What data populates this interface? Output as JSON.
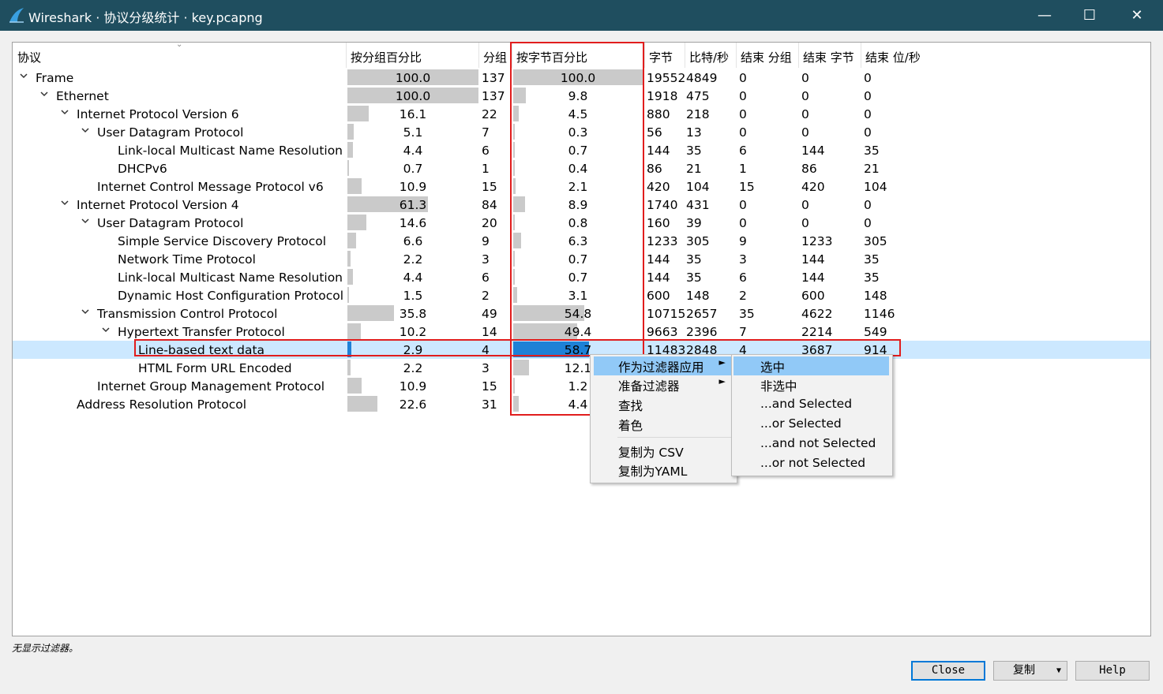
{
  "window": {
    "title": "Wireshark · 协议分级统计 · key.pcapng"
  },
  "columns": [
    "协议",
    "按分组百分比",
    "分组",
    "按字节百分比",
    "字节",
    "比特/秒",
    "结束 分组",
    "结束 字节",
    "结束 位/秒"
  ],
  "rows": [
    {
      "depth": 0,
      "expand": true,
      "name": "Frame",
      "pkt_pct": "100.0",
      "pkts": "137",
      "byte_pct": "100.0",
      "bytes": "19552",
      "bps": "4849",
      "end_pkts": "0",
      "end_bytes": "0",
      "end_bps": "0"
    },
    {
      "depth": 1,
      "expand": true,
      "name": "Ethernet",
      "pkt_pct": "100.0",
      "pkts": "137",
      "byte_pct": "9.8",
      "bytes": "1918",
      "bps": "475",
      "end_pkts": "0",
      "end_bytes": "0",
      "end_bps": "0"
    },
    {
      "depth": 2,
      "expand": true,
      "name": "Internet Protocol Version 6",
      "pkt_pct": "16.1",
      "pkts": "22",
      "byte_pct": "4.5",
      "bytes": "880",
      "bps": "218",
      "end_pkts": "0",
      "end_bytes": "0",
      "end_bps": "0"
    },
    {
      "depth": 3,
      "expand": true,
      "name": "User Datagram Protocol",
      "pkt_pct": "5.1",
      "pkts": "7",
      "byte_pct": "0.3",
      "bytes": "56",
      "bps": "13",
      "end_pkts": "0",
      "end_bytes": "0",
      "end_bps": "0"
    },
    {
      "depth": 4,
      "expand": false,
      "name": "Link-local Multicast Name Resolution",
      "pkt_pct": "4.4",
      "pkts": "6",
      "byte_pct": "0.7",
      "bytes": "144",
      "bps": "35",
      "end_pkts": "6",
      "end_bytes": "144",
      "end_bps": "35"
    },
    {
      "depth": 4,
      "expand": false,
      "name": "DHCPv6",
      "pkt_pct": "0.7",
      "pkts": "1",
      "byte_pct": "0.4",
      "bytes": "86",
      "bps": "21",
      "end_pkts": "1",
      "end_bytes": "86",
      "end_bps": "21"
    },
    {
      "depth": 3,
      "expand": false,
      "name": "Internet Control Message Protocol v6",
      "pkt_pct": "10.9",
      "pkts": "15",
      "byte_pct": "2.1",
      "bytes": "420",
      "bps": "104",
      "end_pkts": "15",
      "end_bytes": "420",
      "end_bps": "104"
    },
    {
      "depth": 2,
      "expand": true,
      "name": "Internet Protocol Version 4",
      "pkt_pct": "61.3",
      "pkts": "84",
      "byte_pct": "8.9",
      "bytes": "1740",
      "bps": "431",
      "end_pkts": "0",
      "end_bytes": "0",
      "end_bps": "0"
    },
    {
      "depth": 3,
      "expand": true,
      "name": "User Datagram Protocol",
      "pkt_pct": "14.6",
      "pkts": "20",
      "byte_pct": "0.8",
      "bytes": "160",
      "bps": "39",
      "end_pkts": "0",
      "end_bytes": "0",
      "end_bps": "0"
    },
    {
      "depth": 4,
      "expand": false,
      "name": "Simple Service Discovery Protocol",
      "pkt_pct": "6.6",
      "pkts": "9",
      "byte_pct": "6.3",
      "bytes": "1233",
      "bps": "305",
      "end_pkts": "9",
      "end_bytes": "1233",
      "end_bps": "305"
    },
    {
      "depth": 4,
      "expand": false,
      "name": "Network Time Protocol",
      "pkt_pct": "2.2",
      "pkts": "3",
      "byte_pct": "0.7",
      "bytes": "144",
      "bps": "35",
      "end_pkts": "3",
      "end_bytes": "144",
      "end_bps": "35"
    },
    {
      "depth": 4,
      "expand": false,
      "name": "Link-local Multicast Name Resolution",
      "pkt_pct": "4.4",
      "pkts": "6",
      "byte_pct": "0.7",
      "bytes": "144",
      "bps": "35",
      "end_pkts": "6",
      "end_bytes": "144",
      "end_bps": "35"
    },
    {
      "depth": 4,
      "expand": false,
      "name": "Dynamic Host Configuration Protocol",
      "pkt_pct": "1.5",
      "pkts": "2",
      "byte_pct": "3.1",
      "bytes": "600",
      "bps": "148",
      "end_pkts": "2",
      "end_bytes": "600",
      "end_bps": "148"
    },
    {
      "depth": 3,
      "expand": true,
      "name": "Transmission Control Protocol",
      "pkt_pct": "35.8",
      "pkts": "49",
      "byte_pct": "54.8",
      "bytes": "10715",
      "bps": "2657",
      "end_pkts": "35",
      "end_bytes": "4622",
      "end_bps": "1146"
    },
    {
      "depth": 4,
      "expand": true,
      "name": "Hypertext Transfer Protocol",
      "pkt_pct": "10.2",
      "pkts": "14",
      "byte_pct": "49.4",
      "bytes": "9663",
      "bps": "2396",
      "end_pkts": "7",
      "end_bytes": "2214",
      "end_bps": "549"
    },
    {
      "depth": 5,
      "expand": false,
      "selected": true,
      "name": "Line-based text data",
      "pkt_pct": "2.9",
      "pkts": "4",
      "byte_pct": "58.7",
      "bytes": "11483",
      "bps": "2848",
      "end_pkts": "4",
      "end_bytes": "3687",
      "end_bps": "914"
    },
    {
      "depth": 5,
      "expand": false,
      "name": "HTML Form URL Encoded",
      "pkt_pct": "2.2",
      "pkts": "3",
      "byte_pct": "12.1",
      "bytes": "",
      "bps": "",
      "end_pkts": "",
      "end_bytes": "",
      "end_bps": ""
    },
    {
      "depth": 3,
      "expand": false,
      "name": "Internet Group Management Protocol",
      "pkt_pct": "10.9",
      "pkts": "15",
      "byte_pct": "1.2",
      "bytes": "",
      "bps": "",
      "end_pkts": "",
      "end_bytes": "",
      "end_bps": ""
    },
    {
      "depth": 2,
      "expand": false,
      "name": "Address Resolution Protocol",
      "pkt_pct": "22.6",
      "pkts": "31",
      "byte_pct": "4.4",
      "bytes": "",
      "bps": "",
      "end_pkts": "",
      "end_bytes": "",
      "end_bps": ""
    }
  ],
  "context_menu": {
    "items": [
      "作为过滤器应用",
      "准备过滤器",
      "查找",
      "着色",
      "复制为 CSV",
      "复制为YAML"
    ],
    "submenu": [
      "选中",
      "非选中",
      "...and Selected",
      "...or Selected",
      "...and not Selected",
      "...or not Selected"
    ]
  },
  "status": {
    "text": "无显示过滤器。"
  },
  "buttons": {
    "close": "Close",
    "copy": "复制",
    "help": "Help"
  },
  "colors": {
    "titlebar": "#1f4e5f",
    "selection": "#cce8ff",
    "bar": "#cacaca",
    "bar_selected": "#1e81d6",
    "annotation": "#e11d1d"
  }
}
